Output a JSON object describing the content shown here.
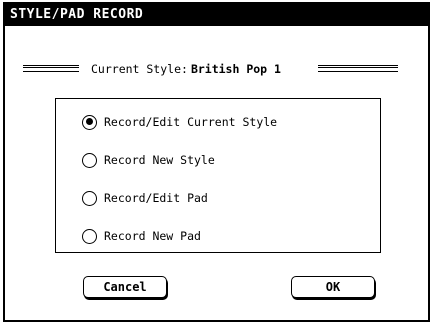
{
  "dialog": {
    "title": "STYLE/PAD RECORD"
  },
  "current_style": {
    "label": "Current Style:",
    "value": "British Pop 1"
  },
  "options": [
    {
      "label": "Record/Edit Current Style",
      "selected": true
    },
    {
      "label": "Record New Style",
      "selected": false
    },
    {
      "label": "Record/Edit Pad",
      "selected": false
    },
    {
      "label": "Record New Pad",
      "selected": false
    }
  ],
  "buttons": {
    "cancel_label": "Cancel",
    "ok_label": "OK"
  }
}
